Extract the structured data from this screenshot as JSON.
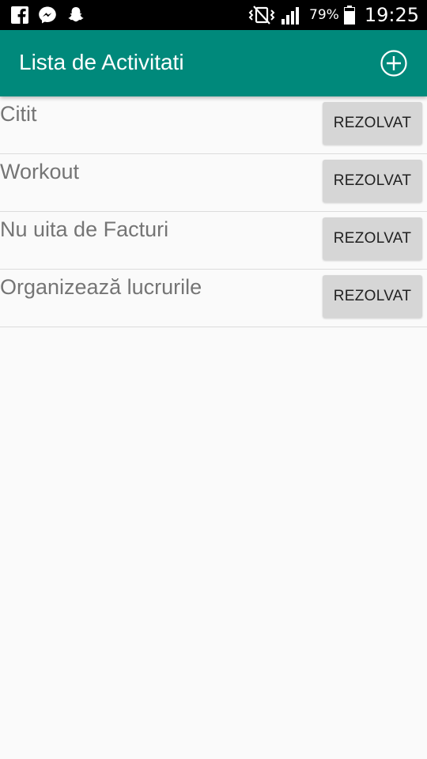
{
  "status_bar": {
    "left_icons": [
      "facebook-icon",
      "messenger-icon",
      "snapchat-icon"
    ],
    "right_icons": [
      "vibrate-icon",
      "signal-icon",
      "battery-icon"
    ],
    "battery_percent": "79%",
    "time": "19:25"
  },
  "app_bar": {
    "title": "Lista de Activitati",
    "add_icon": "add-circle-icon",
    "color": "#00897b"
  },
  "tasks": [
    {
      "label": "Citit",
      "button": "REZOLVAT"
    },
    {
      "label": "Workout",
      "button": "REZOLVAT"
    },
    {
      "label": "Nu uita de Facturi",
      "button": "REZOLVAT"
    },
    {
      "label": "Organizează lucrurile",
      "button": "REZOLVAT"
    }
  ]
}
